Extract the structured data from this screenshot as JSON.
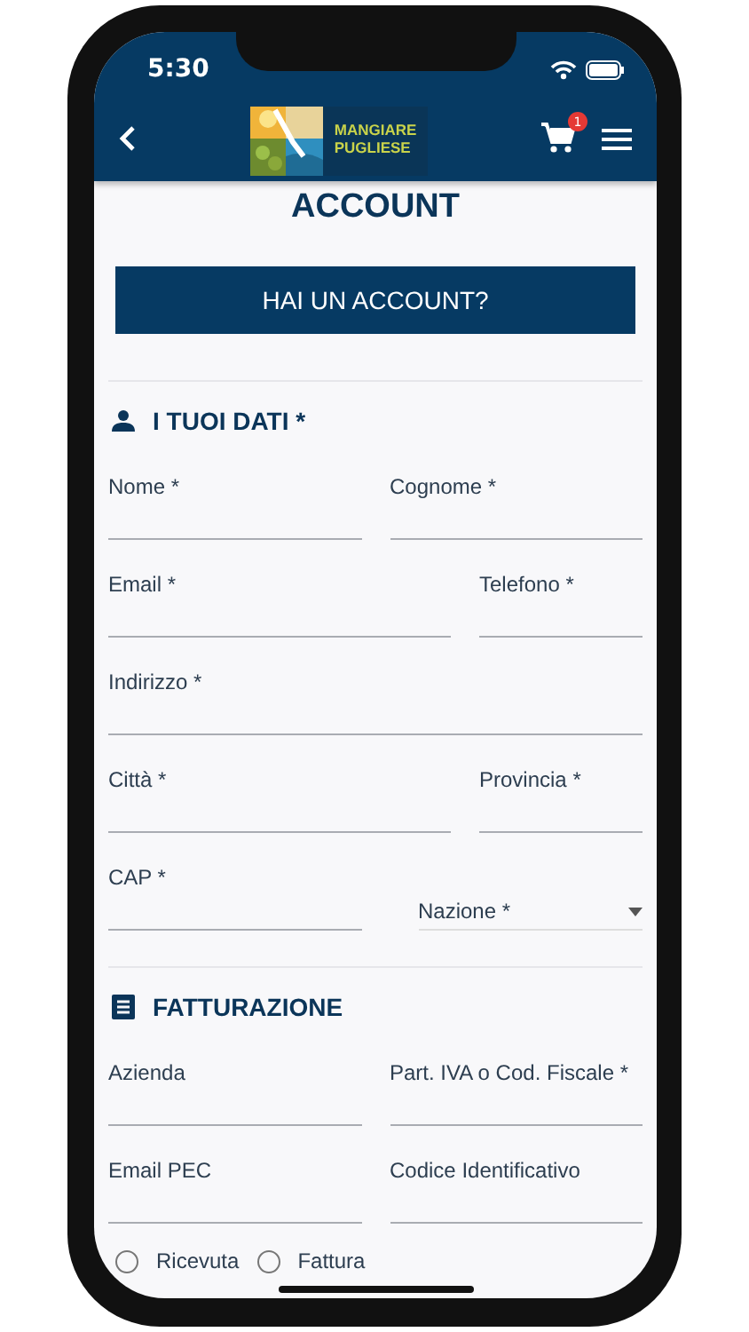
{
  "status_bar": {
    "time": "5:30"
  },
  "nav": {
    "logo_lines": [
      "MANGIARE",
      "PUGLIESE"
    ],
    "cart_count": "1"
  },
  "title": "ACCOUNT",
  "login_button": "HAI UN ACCOUNT?",
  "sections": [
    {
      "kind": "personal",
      "title": "I TUOI DATI *",
      "rows": [
        {
          "kind": "halves",
          "fields": [
            {
              "kind": "text",
              "label": "Nome *"
            },
            {
              "kind": "text",
              "label": "Cognome *"
            }
          ]
        },
        {
          "kind": "wide-narrow",
          "fields": [
            {
              "kind": "text",
              "label": "Email *"
            },
            {
              "kind": "text",
              "label": "Telefono *"
            }
          ]
        },
        {
          "kind": "full",
          "fields": [
            {
              "kind": "text",
              "label": "Indirizzo *"
            }
          ]
        },
        {
          "kind": "wide-narrow",
          "fields": [
            {
              "kind": "text",
              "label": "Città *"
            },
            {
              "kind": "text",
              "label": "Provincia *"
            }
          ]
        },
        {
          "kind": "halves",
          "fields": [
            {
              "kind": "text",
              "label": "CAP *"
            },
            {
              "kind": "select",
              "label": "Nazione *"
            }
          ]
        }
      ]
    },
    {
      "kind": "billing",
      "title": "FATTURAZIONE",
      "rows": [
        {
          "kind": "halves",
          "fields": [
            {
              "kind": "text",
              "label": "Azienda"
            },
            {
              "kind": "text",
              "label": "Part. IVA o Cod. Fiscale *"
            }
          ]
        },
        {
          "kind": "halves",
          "fields": [
            {
              "kind": "text",
              "label": "Email PEC"
            },
            {
              "kind": "text",
              "label": "Codice Identificativo"
            }
          ]
        }
      ],
      "radios": [
        {
          "label": "Ricevuta",
          "selected": false
        },
        {
          "label": "Fattura",
          "selected": false
        }
      ]
    }
  ]
}
